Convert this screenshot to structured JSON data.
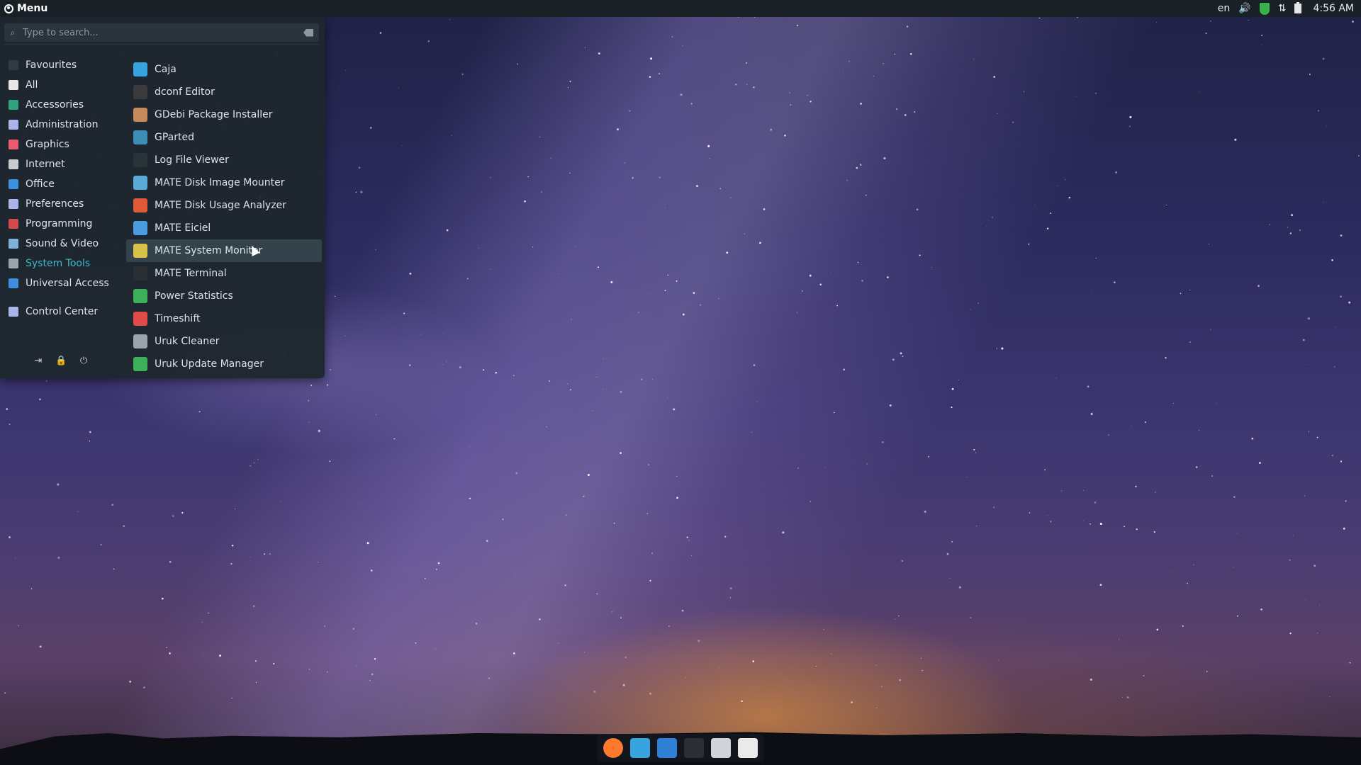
{
  "top_panel": {
    "menu_label": "Menu",
    "tray": {
      "keyboard_layout": "en",
      "clock": "4:56 AM"
    }
  },
  "menu": {
    "search": {
      "placeholder": "Type to search..."
    },
    "categories": [
      {
        "label": "Favourites",
        "icon": "star-icon",
        "color": "#2f3b41"
      },
      {
        "label": "All",
        "icon": "all-icon",
        "color": "#e7e7e7"
      },
      {
        "label": "Accessories",
        "icon": "accessories-icon",
        "color": "#2fa37c"
      },
      {
        "label": "Administration",
        "icon": "administration-icon",
        "color": "#a9b4ea"
      },
      {
        "label": "Graphics",
        "icon": "graphics-icon",
        "color": "#e95a6c"
      },
      {
        "label": "Internet",
        "icon": "internet-icon",
        "color": "#c9cdd0"
      },
      {
        "label": "Office",
        "icon": "office-icon",
        "color": "#3d8fe0"
      },
      {
        "label": "Preferences",
        "icon": "preferences-icon",
        "color": "#a9b4ea"
      },
      {
        "label": "Programming",
        "icon": "programming-icon",
        "color": "#d44a4a"
      },
      {
        "label": "Sound & Video",
        "icon": "sound-video-icon",
        "color": "#7fb0d8"
      },
      {
        "label": "System Tools",
        "icon": "system-tools-icon",
        "color": "#9aa4aa",
        "active": true
      },
      {
        "label": "Universal Access",
        "icon": "universal-access-icon",
        "color": "#3d8fe0"
      }
    ],
    "extra_category": {
      "label": "Control Center",
      "icon": "control-center-icon",
      "color": "#a9b4ea"
    },
    "apps": [
      {
        "label": "Caja",
        "icon": "caja-icon",
        "color": "#37a3df"
      },
      {
        "label": "dconf Editor",
        "icon": "dconf-editor-icon",
        "color": "#3b3b3b"
      },
      {
        "label": "GDebi Package Installer",
        "icon": "gdebi-icon",
        "color": "#c48a5a"
      },
      {
        "label": "GParted",
        "icon": "gparted-icon",
        "color": "#3b8fb6"
      },
      {
        "label": "Log File Viewer",
        "icon": "log-file-viewer-icon",
        "color": "#2a3338"
      },
      {
        "label": "MATE Disk Image Mounter",
        "icon": "disk-image-mounter-icon",
        "color": "#5aa9d6"
      },
      {
        "label": "MATE Disk Usage Analyzer",
        "icon": "disk-usage-analyzer-icon",
        "color": "#e05a3a"
      },
      {
        "label": "MATE Eiciel",
        "icon": "eiciel-icon",
        "color": "#4a9be0"
      },
      {
        "label": "MATE System Monitor",
        "icon": "system-monitor-icon",
        "color": "#d8c24a",
        "hover": true
      },
      {
        "label": "MATE Terminal",
        "icon": "terminal-icon",
        "color": "#2a2f33"
      },
      {
        "label": "Power Statistics",
        "icon": "power-statistics-icon",
        "color": "#3fb05a"
      },
      {
        "label": "Timeshift",
        "icon": "timeshift-icon",
        "color": "#e04a4a"
      },
      {
        "label": "Uruk Cleaner",
        "icon": "uruk-cleaner-icon",
        "color": "#9aa4aa"
      },
      {
        "label": "Uruk Update Manager",
        "icon": "uruk-update-manager-icon",
        "color": "#3fb05a"
      }
    ]
  },
  "dock": {
    "items": [
      {
        "name": "firefox-icon",
        "color": "#ff7a2f"
      },
      {
        "name": "files-icon",
        "color": "#37a3df"
      },
      {
        "name": "mail-icon",
        "color": "#2f7fd6"
      },
      {
        "name": "terminal-icon",
        "color": "#2a2f33"
      },
      {
        "name": "text-editor-icon",
        "color": "#d0d4d8"
      },
      {
        "name": "task-manager-icon",
        "color": "#eaeaea"
      }
    ]
  }
}
